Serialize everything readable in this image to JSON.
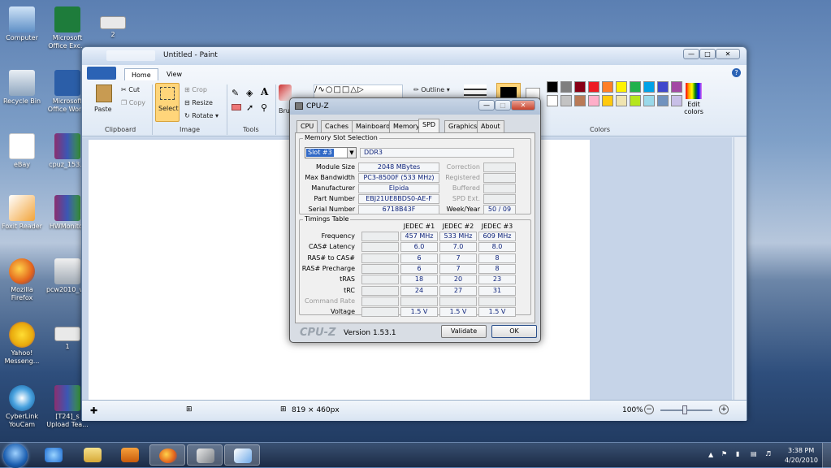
{
  "desktop": {
    "icons": [
      {
        "label": "Computer"
      },
      {
        "label": "Microsoft Office Exc..."
      },
      {
        "label": "2"
      },
      {
        "label": "Recycle Bin"
      },
      {
        "label": "Microsoft Office Wor..."
      },
      {
        "label": "eBay"
      },
      {
        "label": "cpuz_153..."
      },
      {
        "label": "Foxit Reader"
      },
      {
        "label": "HWMonitor"
      },
      {
        "label": "Mozilla Firefox"
      },
      {
        "label": "pcw2010_v..."
      },
      {
        "label": "Yahoo! Messeng..."
      },
      {
        "label": "1"
      },
      {
        "label": "CyberLink YouCam"
      },
      {
        "label": "[T24]_s Upload Tea..."
      }
    ]
  },
  "paint": {
    "title": "Untitled - Paint",
    "tabs": [
      "Home",
      "View"
    ],
    "clipboard": {
      "paste": "Paste",
      "cut": "Cut",
      "copy": "Copy",
      "label": "Clipboard"
    },
    "image": {
      "select": "Select",
      "crop": "Crop",
      "resize": "Resize",
      "rotate": "Rotate",
      "label": "Image"
    },
    "tools": {
      "label": "Tools"
    },
    "brushes": "Bru",
    "shapes": {
      "outline": "Outline"
    },
    "colors": {
      "edit": "Edit colors",
      "label": "Colors",
      "row1": [
        "#000000",
        "#7f7f7f",
        "#880015",
        "#ed1c24",
        "#ff7f27",
        "#fff200",
        "#22b14c",
        "#00a2e8",
        "#3f48cc",
        "#a349a4"
      ],
      "row2": [
        "#ffffff",
        "#c3c3c3",
        "#b97a57",
        "#ffaec9",
        "#ffc90e",
        "#efe4b0",
        "#b5e61d",
        "#99d9ea",
        "#7092be",
        "#c8bfe7"
      ]
    },
    "status": {
      "dimensions": "819 × 460px",
      "zoom": "100%"
    }
  },
  "cpuz": {
    "title": "CPU-Z",
    "tabs": [
      "CPU",
      "Caches",
      "Mainboard",
      "Memory",
      "SPD",
      "Graphics",
      "About"
    ],
    "memory_slot_selection": "Memory Slot Selection",
    "slot": "Slot #3",
    "type": "DDR3",
    "fields": [
      {
        "label": "Module Size",
        "value": "2048 MBytes",
        "rlabel": "Correction",
        "rvalue": ""
      },
      {
        "label": "Max Bandwidth",
        "value": "PC3-8500F (533 MHz)",
        "rlabel": "Registered",
        "rvalue": ""
      },
      {
        "label": "Manufacturer",
        "value": "Elpida",
        "rlabel": "Buffered",
        "rvalue": ""
      },
      {
        "label": "Part Number",
        "value": "EBJ21UE8BDS0-AE-F",
        "rlabel": "SPD Ext.",
        "rvalue": ""
      },
      {
        "label": "Serial Number",
        "value": "6718B43F",
        "rlabel": "Week/Year",
        "rvalue": "50 / 09"
      }
    ],
    "timings_table": "Timings Table",
    "timing_headers": [
      "JEDEC #1",
      "JEDEC #2",
      "JEDEC #3"
    ],
    "timings": [
      {
        "label": "Frequency",
        "values": [
          "457 MHz",
          "533 MHz",
          "609 MHz"
        ]
      },
      {
        "label": "CAS# Latency",
        "values": [
          "6.0",
          "7.0",
          "8.0"
        ]
      },
      {
        "label": "RAS# to CAS#",
        "values": [
          "6",
          "7",
          "8"
        ]
      },
      {
        "label": "RAS# Precharge",
        "values": [
          "6",
          "7",
          "8"
        ]
      },
      {
        "label": "tRAS",
        "values": [
          "18",
          "20",
          "23"
        ]
      },
      {
        "label": "tRC",
        "values": [
          "24",
          "27",
          "31"
        ]
      },
      {
        "label": "Command Rate",
        "values": [
          "",
          "",
          ""
        ]
      },
      {
        "label": "Voltage",
        "values": [
          "1.5 V",
          "1.5 V",
          "1.5 V"
        ]
      }
    ],
    "brand": "CPU-Z",
    "version": "Version 1.53.1",
    "validate": "Validate",
    "ok": "OK"
  },
  "taskbar": {
    "time": "3:38 PM",
    "date": "4/20/2010"
  }
}
